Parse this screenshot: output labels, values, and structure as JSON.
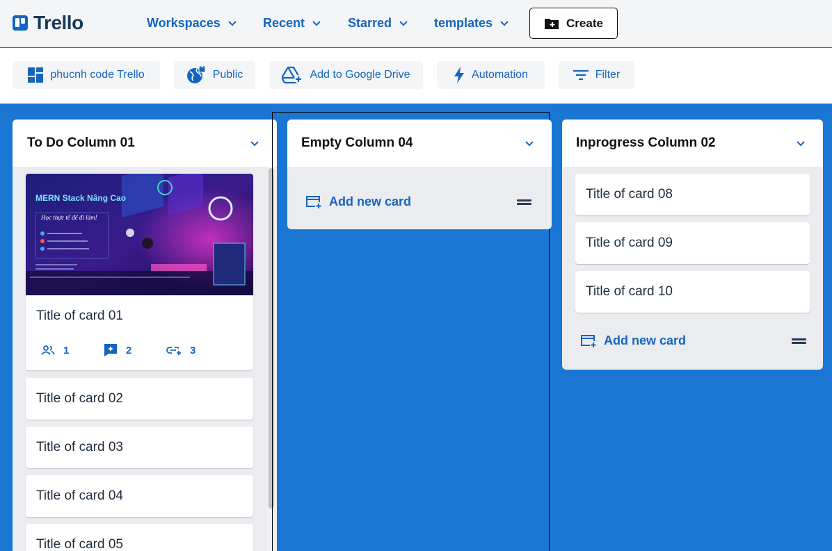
{
  "app": {
    "name": "Trello"
  },
  "nav": {
    "items": [
      {
        "label": "Workspaces"
      },
      {
        "label": "Recent"
      },
      {
        "label": "Starred"
      },
      {
        "label": "templates"
      }
    ],
    "create_label": "Create"
  },
  "board_bar": {
    "board_name": "phucnh code Trello",
    "visibility": "Public",
    "google_drive": "Add to Google Drive",
    "automation": "Automation",
    "filter": "Filter"
  },
  "columns": [
    {
      "title": "To Do Column 01",
      "cards": [
        {
          "title": "Title of card 01",
          "cover": {
            "heading": "MERN Stack Nâng Cao",
            "tagline": "Học thực tế để đi làm!"
          },
          "members": "1",
          "comments": "2",
          "attachments": "3"
        },
        {
          "title": "Title of card 02"
        },
        {
          "title": "Title of card 03"
        },
        {
          "title": "Title of card 04"
        },
        {
          "title": "Title of card 05"
        }
      ]
    },
    {
      "title": "Empty Column 04",
      "add_card_label": "Add new card"
    },
    {
      "title": "Inprogress Column 02",
      "cards": [
        {
          "title": "Title of card 08"
        },
        {
          "title": "Title of card 09"
        },
        {
          "title": "Title of card 10"
        }
      ],
      "add_card_label": "Add new card"
    }
  ],
  "colors": {
    "board_bg": "#1976d2",
    "accent": "#1565c0",
    "column_bg": "#ebecf0"
  }
}
